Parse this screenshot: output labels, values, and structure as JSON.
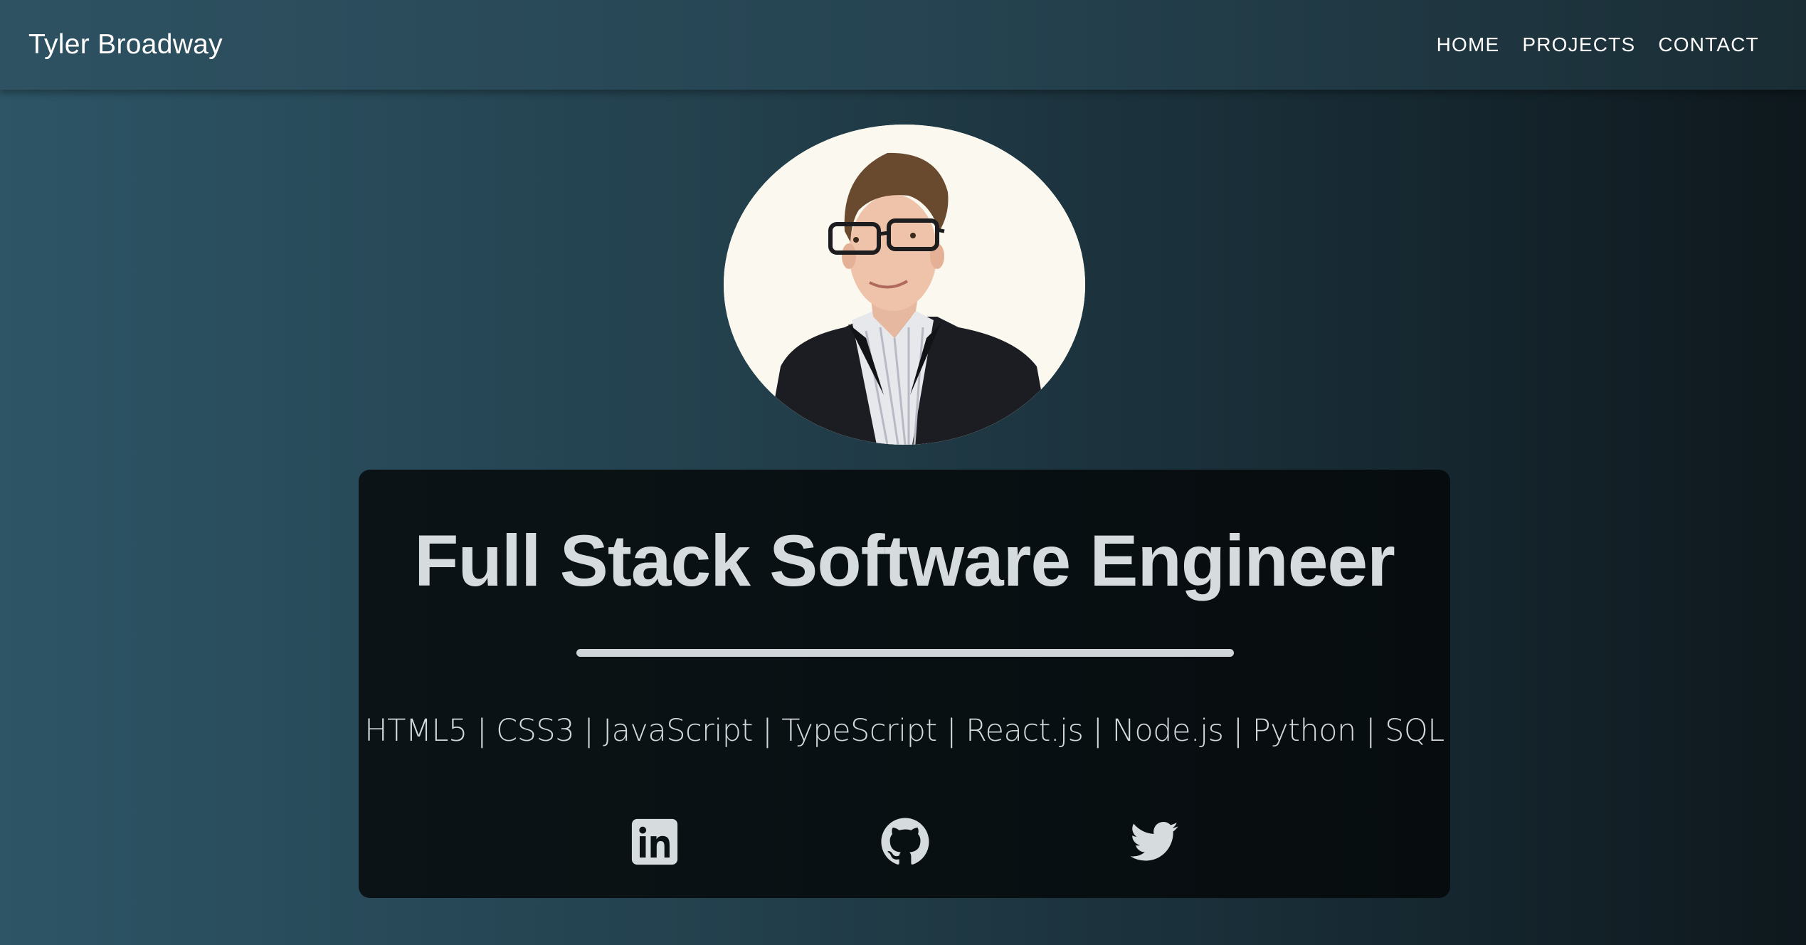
{
  "header": {
    "brand": "Tyler Broadway",
    "nav": [
      "HOME",
      "PROJECTS",
      "CONTACT"
    ]
  },
  "hero": {
    "avatar_icon": "profile-photo",
    "headline": "Full Stack Software Engineer",
    "skills": "HTML5 | CSS3 | JavaScript | TypeScript | React.js | Node.js | Python | SQL",
    "social": [
      "linkedin-icon",
      "github-icon",
      "twitter-icon"
    ]
  },
  "colors": {
    "background_left": "#2d5566",
    "background_right": "#0e181d",
    "card": "#080f11",
    "text": "#d6dbde"
  }
}
